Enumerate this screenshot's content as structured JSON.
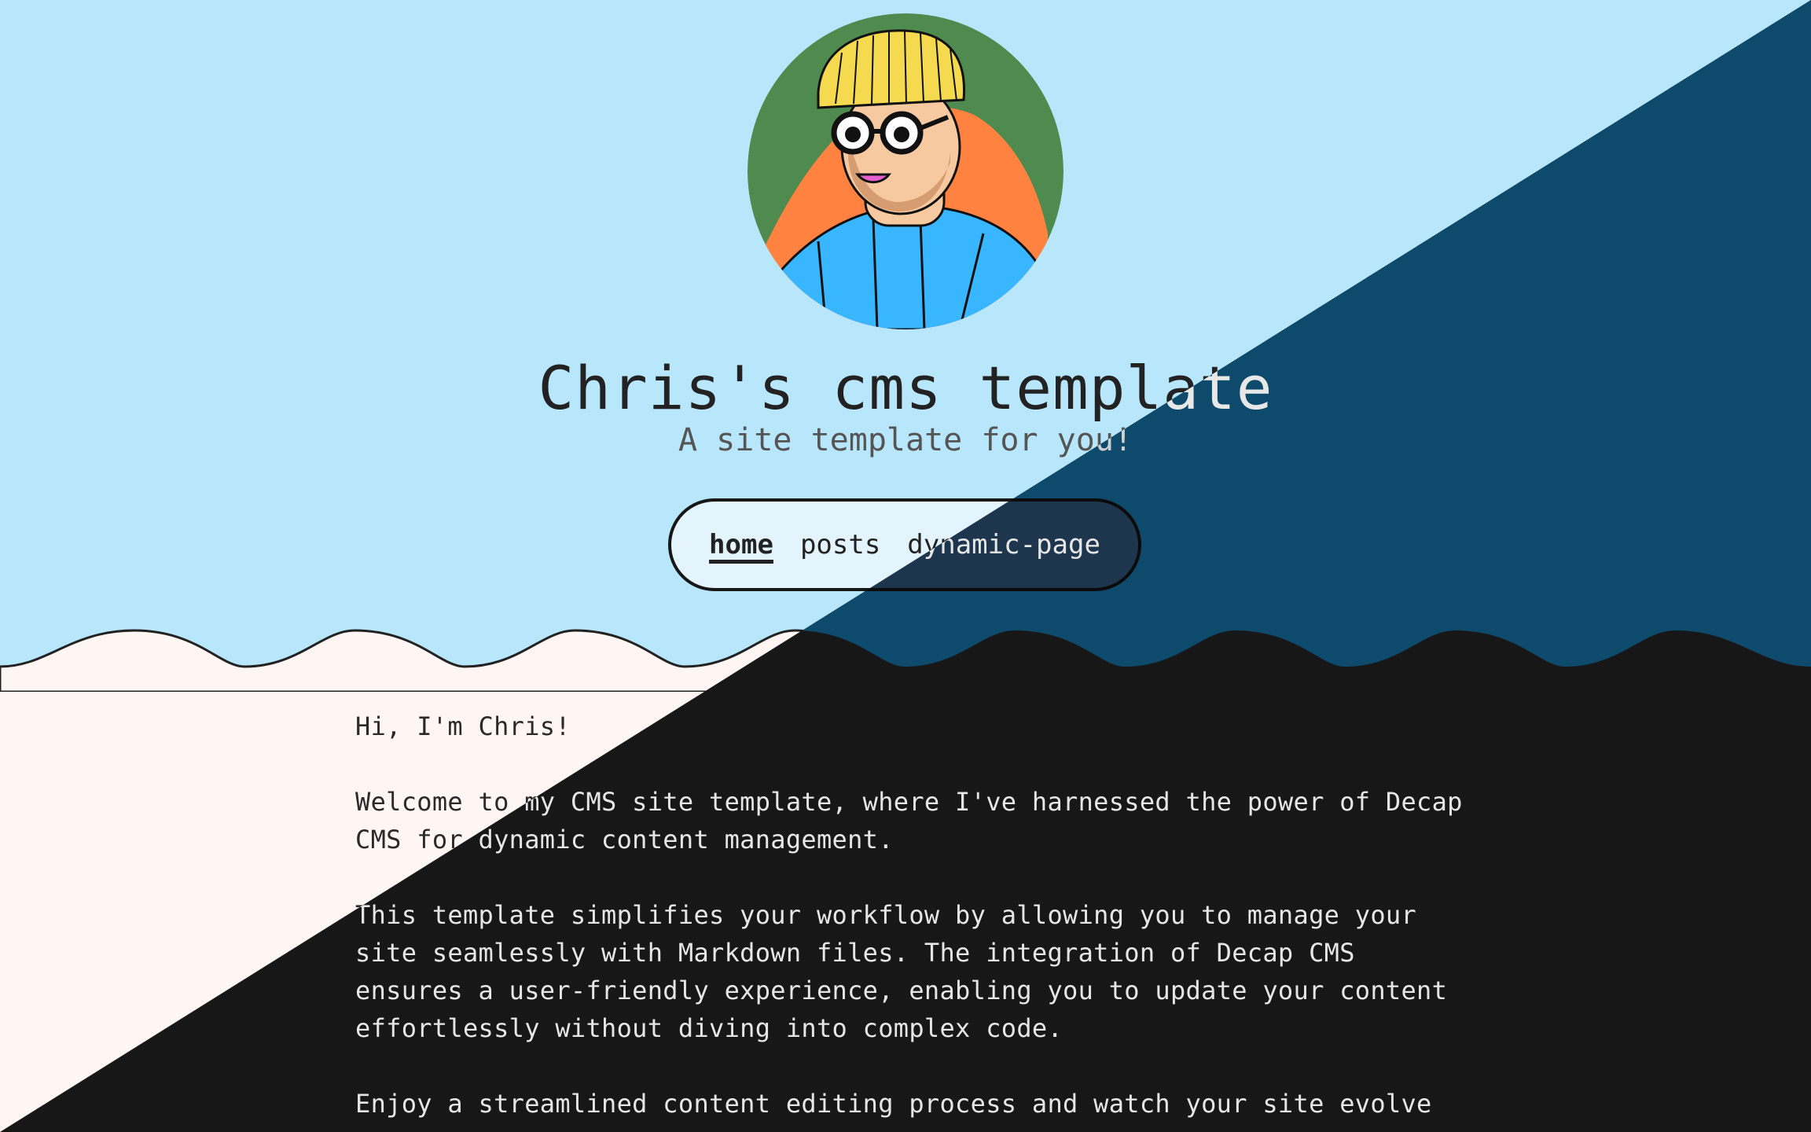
{
  "site": {
    "title": "Chris's cms template",
    "subtitle": "A site template for you!"
  },
  "nav": {
    "items": [
      {
        "label": "home",
        "active": true
      },
      {
        "label": "posts",
        "active": false
      },
      {
        "label": "dynamic-page",
        "active": false
      }
    ]
  },
  "content": {
    "paragraphs": [
      "Hi, I'm Chris!",
      "Welcome to my CMS site template, where I've harnessed the power of Decap CMS for dynamic content management.",
      "This template simplifies your workflow by allowing you to manage your site seamlessly with Markdown files. The integration of Decap CMS ensures a user-friendly experience, enabling you to update your content effortlessly without diving into complex code.",
      "Enjoy a streamlined content editing process and watch your site evolve"
    ]
  },
  "avatar": {
    "icon": "person-avatar-icon"
  },
  "colors": {
    "light_hero": "#b8e6fb",
    "light_body": "#fff6f4",
    "dark_hero": "#0d4a6c",
    "dark_body": "#171717",
    "avatar_bg": "#4f8a4f",
    "beanie": "#f5d94e",
    "hair": "#ff8240",
    "sweater": "#38b6ff"
  }
}
